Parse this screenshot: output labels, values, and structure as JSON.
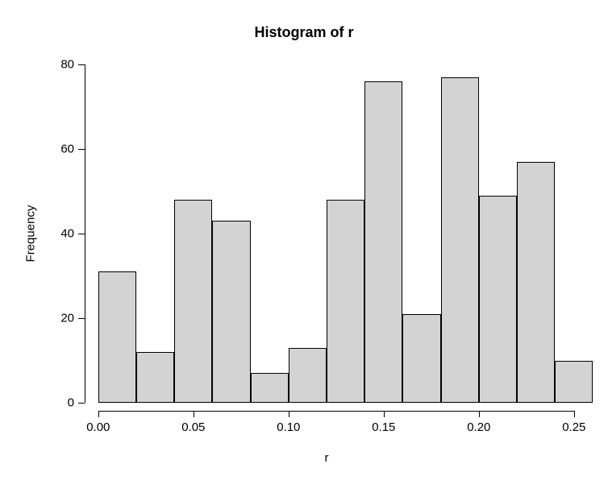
{
  "chart_data": {
    "type": "bar",
    "title": "Histogram of r",
    "xlabel": "r",
    "ylabel": "Frequency",
    "xlim": [
      0.0,
      0.25
    ],
    "ylim": [
      0,
      80
    ],
    "x_ticks": [
      0.0,
      0.05,
      0.1,
      0.15,
      0.2,
      0.25
    ],
    "x_tick_labels": [
      "0.00",
      "0.05",
      "0.10",
      "0.15",
      "0.20",
      "0.25"
    ],
    "y_ticks": [
      0,
      20,
      40,
      60,
      80
    ],
    "y_tick_labels": [
      "0",
      "20",
      "40",
      "60",
      "80"
    ],
    "bin_width": 0.02,
    "bin_starts": [
      0.0,
      0.02,
      0.04,
      0.06,
      0.08,
      0.1,
      0.12,
      0.14,
      0.16,
      0.18,
      0.2,
      0.22,
      0.24
    ],
    "values": [
      31,
      12,
      48,
      43,
      7,
      13,
      48,
      76,
      21,
      77,
      49,
      57,
      10
    ],
    "bar_fill": "#d3d3d3",
    "bar_stroke": "#000000"
  }
}
